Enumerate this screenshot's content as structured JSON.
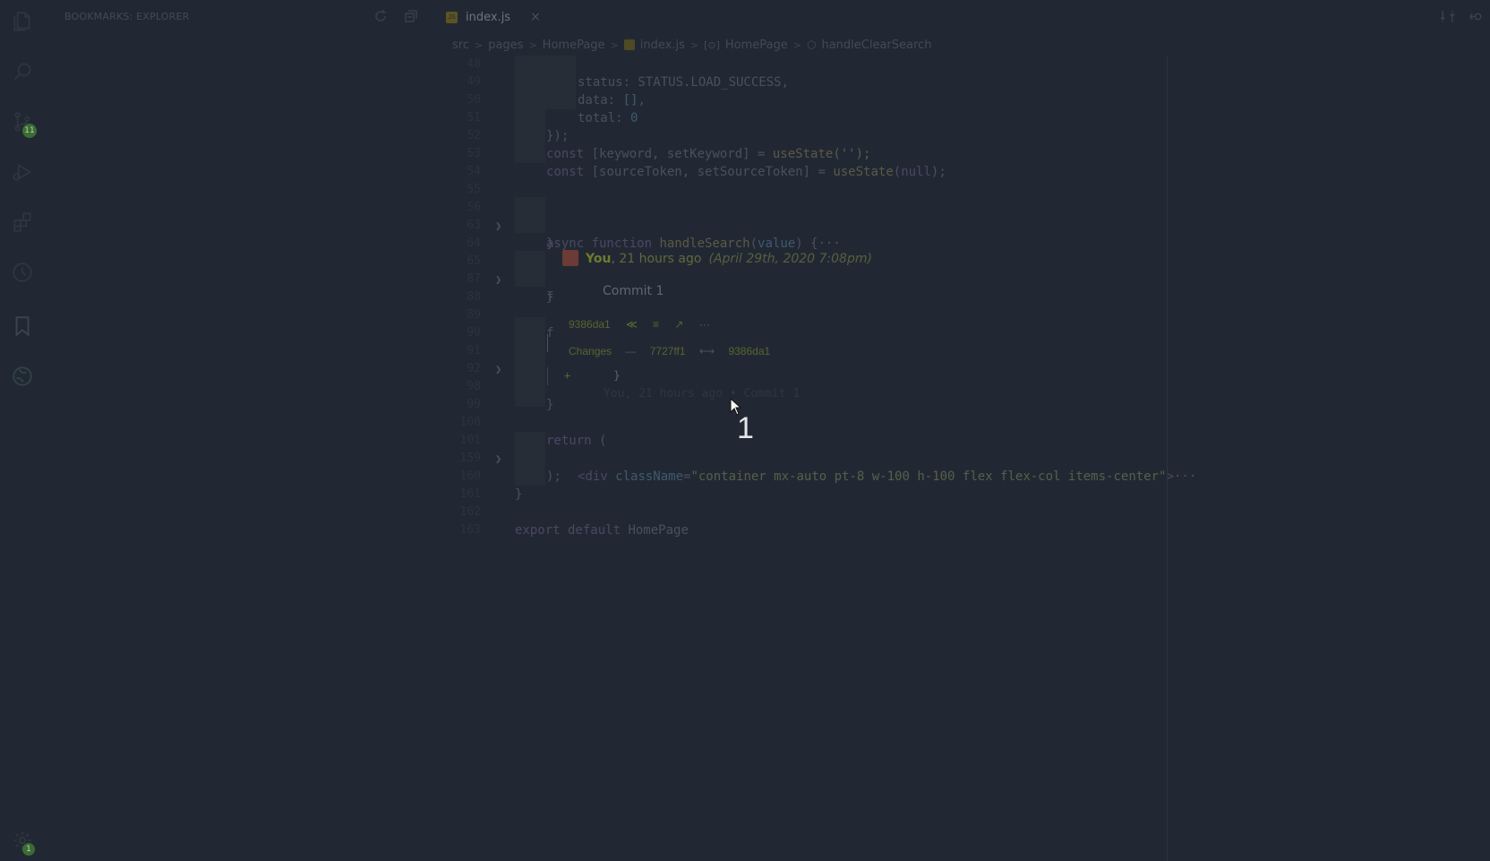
{
  "sidebar": {
    "title": "BOOKMARKS: EXPLORER",
    "scm_badge": "11",
    "settings_badge": "1"
  },
  "tab": {
    "label": "index.js",
    "file_icon": "JS",
    "close": "×"
  },
  "breadcrumb": {
    "src": "src",
    "pages": "pages",
    "homepage_folder": "HomePage",
    "file": "index.js",
    "component": "HomePage",
    "symbol": "handleClearSearch"
  },
  "code": {
    "l1": "status: STATUS.LOAD_SUCCESS,",
    "l2_a": "data: ",
    "l2_b": "[]",
    "l2_c": ",",
    "l3_a": "total: ",
    "l3_b": "0",
    "l4": "});",
    "l5_kw": "const",
    "l5_a": " [keyword, setKeyword] = ",
    "l5_fn": "useState",
    "l5_b": "('');",
    "l6_kw": "const",
    "l6_a": " [sourceToken, setSourceToken] = ",
    "l6_fn": "useState",
    "l6_b": "(",
    "l6_null": "null",
    "l6_c": ");",
    "l9_kw": "async function ",
    "l9_fn": "handleSearch",
    "l9_a": "(",
    "l9_p": "value",
    "l9_b": ") {",
    "l9_dots": "···",
    "close_brace": "}",
    "f": "f",
    "return_kw": "return",
    "return_b": " (",
    "div_a": "<div ",
    "div_attr": "className",
    "div_eq": "=",
    "div_str": "\"container mx-auto pt-8 w-100 h-100 flex flex-col items-center\"",
    "div_b": ">",
    "div_dots": "···",
    "paren_close": ");",
    "export_kw": "export default ",
    "export_name": "HomePage"
  },
  "line_numbers": [
    "48",
    "49",
    "50",
    "51",
    "52",
    "53",
    "54",
    "55",
    "56",
    "63",
    "64",
    "65",
    "87",
    "88",
    "89",
    "90",
    "91",
    "92",
    "98",
    "99",
    "100",
    "101",
    "159",
    "160",
    "161",
    "162",
    "163"
  ],
  "blame": {
    "author": "You",
    "time": ", 21 hours ago",
    "date": "(April 29th, 2020 7:08pm)",
    "message": "Commit 1",
    "sha": "9386da1",
    "changes_label": "Changes",
    "dash": "—",
    "from_sha": "7727ff1",
    "arrow": "⟷",
    "to_sha": "9386da1",
    "diff_plus": "+",
    "diff_brace": "}",
    "ghost": "You, 21 hours ago • Commit 1",
    "action_icons": [
      "≪",
      "≡",
      "↗",
      "···"
    ]
  },
  "overlay": {
    "step_number": "1"
  }
}
